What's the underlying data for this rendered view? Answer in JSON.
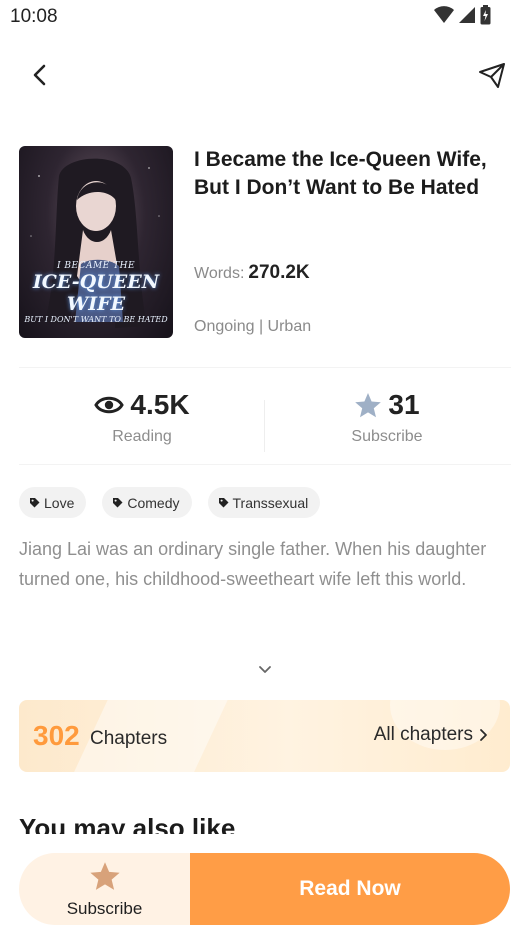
{
  "status_bar": {
    "time": "10:08"
  },
  "book": {
    "title": "I Became the Ice-Queen Wife, But I Don’t Want to Be Hated",
    "words_label": "Words:",
    "words_value": "270.2K",
    "meta": "Ongoing | Urban",
    "cover": {
      "line1": "I BECAME THE",
      "line2": "ICE-QUEEN WIFE",
      "line3": "BUT I DON'T WANT TO BE HATED"
    }
  },
  "stats": {
    "reading_value": "4.5K",
    "reading_label": "Reading",
    "subscribe_value": "31",
    "subscribe_label": "Subscribe"
  },
  "tags": [
    "Love",
    "Comedy",
    "Transsexual"
  ],
  "description": "Jiang Lai was an ordinary single father. When his daughter turned one, his childhood-sweetheart wife left this world.",
  "chapters": {
    "count": "302",
    "label": "Chapters",
    "all_label": "All chapters"
  },
  "section_title": "You may also like",
  "bottom": {
    "subscribe_label": "Subscribe",
    "read_label": "Read Now"
  },
  "colors": {
    "accent": "#ff9d46",
    "chapters_count": "#ff9a3c",
    "star_gray": "#9fb0c6",
    "star_accent": "#d8a27a"
  }
}
